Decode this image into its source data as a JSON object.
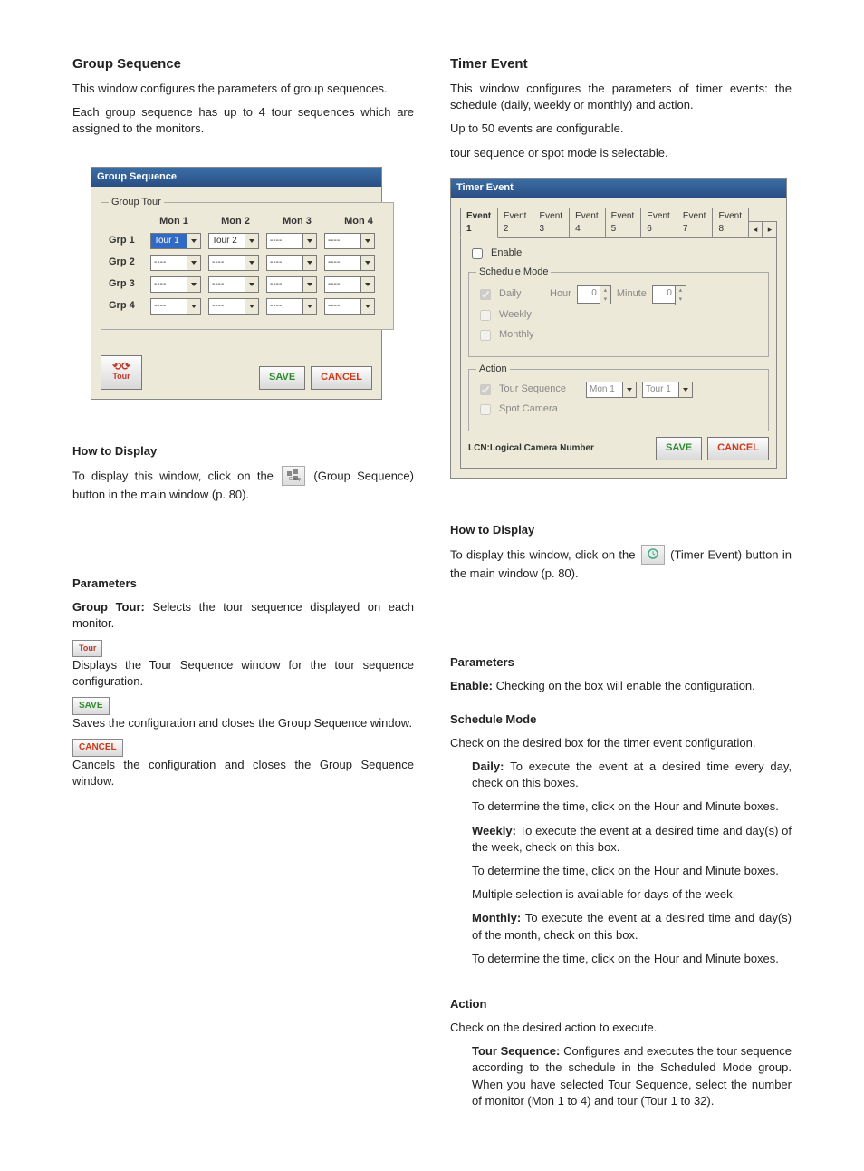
{
  "left": {
    "title": "Group Sequence",
    "intro1": "This window configures the parameters of group sequences.",
    "intro2": "Each group sequence has up to 4 tour sequences which are assigned to the monitors.",
    "win_title": "Group Sequence",
    "frame_title": "Group Tour",
    "headers": [
      "Mon 1",
      "Mon 2",
      "Mon 3",
      "Mon 4"
    ],
    "rows": [
      {
        "label": "Grp 1",
        "cells": [
          "Tour 1",
          "Tour 2",
          "----",
          "----"
        ],
        "selectedIndex": 0
      },
      {
        "label": "Grp 2",
        "cells": [
          "----",
          "----",
          "----",
          "----"
        ]
      },
      {
        "label": "Grp 3",
        "cells": [
          "----",
          "----",
          "----",
          "----"
        ]
      },
      {
        "label": "Grp 4",
        "cells": [
          "----",
          "----",
          "----",
          "----"
        ]
      }
    ],
    "tour_btn": "Tour",
    "save": "SAVE",
    "cancel": "CANCEL",
    "howto_title": "How to Display",
    "howto_a": "To display this window, click on the ",
    "howto_b": " (Group Sequence) button in the main window (p. 80).",
    "params_title": "Parameters",
    "param1_label": "Group Tour: ",
    "param1_text": "Selects the tour sequence displayed on each monitor.",
    "tourinline": "Tour",
    "param2": "Displays the Tour Sequence window for the tour sequence configuration.",
    "param3": "Saves the configuration and closes the Group Sequence window.",
    "param4": "Cancels the configuration and closes the Group Sequence window."
  },
  "right": {
    "title": "Timer Event",
    "intro1": "This window configures the parameters of timer events:  the schedule (daily, weekly or monthly) and action.",
    "intro2": "Up to 50 events are configurable.",
    "intro3": "tour sequence or spot mode is selectable.",
    "win_title": "Timer Event",
    "tabs": [
      "Event 1",
      "Event 2",
      "Event 3",
      "Event 4",
      "Event 5",
      "Event 6",
      "Event 7",
      "Event 8"
    ],
    "enable": "Enable",
    "schedule_frame": "Schedule Mode",
    "daily": "Daily",
    "weekly": "Weekly",
    "monthly": "Monthly",
    "hour_label": "Hour",
    "minute_label": "Minute",
    "hour_val": "0",
    "minute_val": "0",
    "action_frame": "Action",
    "tour_sequence": "Tour Sequence",
    "spot_camera": "Spot Camera",
    "mon_sel": "Mon 1",
    "tour_sel": "Tour 1",
    "lcn": "LCN:Logical Camera Number",
    "save": "SAVE",
    "cancel": "CANCEL",
    "howto_title": "How to Display",
    "howto_a": "To display this window, click on the ",
    "howto_b": " (Timer Event) button in the main window (p. 80).",
    "params_title": "Parameters",
    "p_enable_label": "Enable: ",
    "p_enable": "Checking on the box will enable the configuration.",
    "p_sched_label": "Schedule Mode",
    "p_sched": "Check on the desired box for the timer event configuration.",
    "p_daily_label": "Daily: ",
    "p_daily1": "To execute the event at a desired time every day, check on this boxes.",
    "p_daily2": "To determine the time, click on the Hour and Minute boxes.",
    "p_weekly_label": "Weekly: ",
    "p_weekly1": "To execute the event at a desired time and day(s) of the week, check on this box.",
    "p_weekly2": "To determine the time, click on the Hour and Minute boxes.",
    "p_weekly3": "Multiple selection is available for days of the week.",
    "p_monthly_label": "Monthly: ",
    "p_monthly1": "To execute the event at a desired time and day(s) of the month, check on this box.",
    "p_monthly2": "To determine the time, click on the Hour and Minute boxes.",
    "p_action_label": "Action",
    "p_action": "Check on the desired action to execute.",
    "p_ts_label": "Tour Sequence: ",
    "p_ts": "Configures and executes the tour sequence according to the schedule in the Scheduled Mode group. When you have selected Tour Sequence, select the number of monitor (Mon 1 to 4) and tour (Tour 1 to 32)."
  }
}
